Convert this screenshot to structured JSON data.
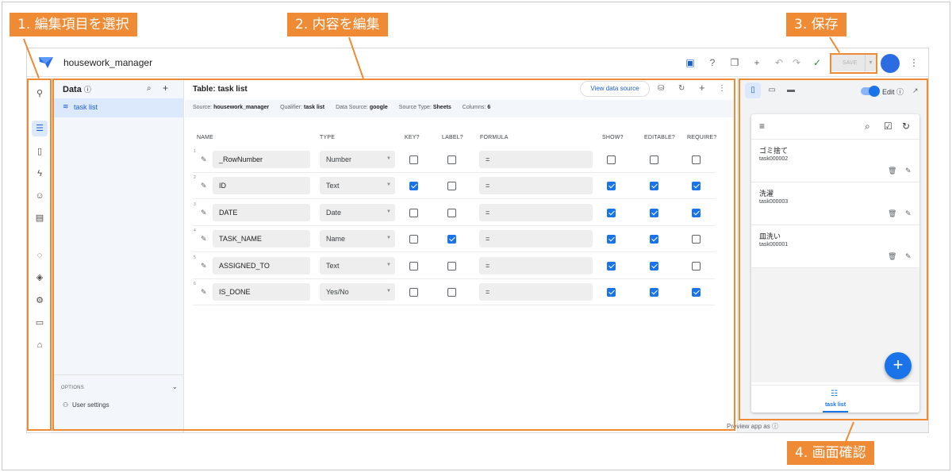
{
  "header": {
    "app_name": "housework_manager",
    "save_label": "SAVE"
  },
  "data_panel": {
    "title": "Data",
    "tables": [
      {
        "label": "task list"
      }
    ],
    "options_label": "OPTIONS",
    "user_settings_label": "User settings"
  },
  "main": {
    "title": "Table: task list",
    "view_data_source": "View data source",
    "info": {
      "source_label": "Source:",
      "source": "housework_manager",
      "qualifier_label": "Qualifier:",
      "qualifier": "task list",
      "data_source_label": "Data Source:",
      "data_source": "google",
      "source_type_label": "Source Type:",
      "source_type": "Sheets",
      "columns_label": "Columns:",
      "columns": "6"
    },
    "column_headers": {
      "name": "NAME",
      "type": "TYPE",
      "key": "KEY?",
      "label": "LABEL?",
      "formula": "FORMULA",
      "show": "SHOW?",
      "editable": "EDITABLE?",
      "require": "REQUIRE?"
    },
    "rows": [
      {
        "num": "1",
        "name": "_RowNumber",
        "type": "Number",
        "formula": "=",
        "key": false,
        "label": false,
        "show": false,
        "editable": false,
        "require": false
      },
      {
        "num": "2",
        "name": "ID",
        "type": "Text",
        "formula": "=",
        "key": true,
        "label": false,
        "show": true,
        "editable": true,
        "require": true
      },
      {
        "num": "3",
        "name": "DATE",
        "type": "Date",
        "formula": "=",
        "key": false,
        "label": false,
        "show": true,
        "editable": true,
        "require": true
      },
      {
        "num": "4",
        "name": "TASK_NAME",
        "type": "Name",
        "formula": "=",
        "key": false,
        "label": true,
        "show": true,
        "editable": true,
        "require": false
      },
      {
        "num": "5",
        "name": "ASSIGNED_TO",
        "type": "Text",
        "formula": "=",
        "key": false,
        "label": false,
        "show": true,
        "editable": true,
        "require": false
      },
      {
        "num": "6",
        "name": "IS_DONE",
        "type": "Yes/No",
        "formula": "=",
        "key": false,
        "label": false,
        "show": true,
        "editable": true,
        "require": true
      }
    ]
  },
  "preview": {
    "edit_label": "Edit",
    "items": [
      {
        "title": "ゴミ捨て",
        "id": "task000002"
      },
      {
        "title": "洗濯",
        "id": "task000003"
      },
      {
        "title": "皿洗い",
        "id": "task000001"
      }
    ],
    "nav_label": "task list",
    "preview_as": "Preview app as"
  },
  "annotations": {
    "step1": "1. 編集項目を選択",
    "step2": "2. 内容を編集",
    "step3": "3. 保存",
    "step4": "4. 画面確認"
  },
  "colors": {
    "accent": "#ef8a35",
    "primary": "#1a73e8"
  }
}
